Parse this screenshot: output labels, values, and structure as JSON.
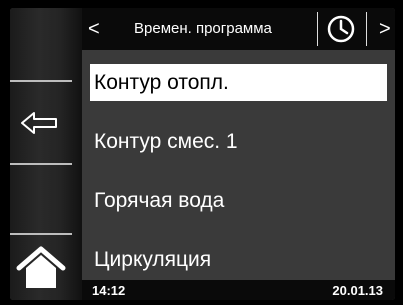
{
  "header": {
    "prev_icon": "chevron-left-icon",
    "prev_glyph": "<",
    "title": "Времен. программа",
    "clock_icon": "clock-icon",
    "next_icon": "chevron-right-icon",
    "next_glyph": ">"
  },
  "sidebar": {
    "back_icon": "back-arrow-icon",
    "home_icon": "home-icon"
  },
  "menu": {
    "items": [
      {
        "label": "Контур отопл.",
        "selected": true
      },
      {
        "label": "Контур смес. 1",
        "selected": false
      },
      {
        "label": "Горячая вода",
        "selected": false
      },
      {
        "label": "Циркуляция",
        "selected": false
      }
    ]
  },
  "footer": {
    "time": "14:12",
    "date": "20.01.13"
  },
  "colors": {
    "background": "#3a3a3a",
    "header_bg": "#0a0a0a",
    "selected_bg": "#ffffff",
    "text": "#ffffff"
  }
}
